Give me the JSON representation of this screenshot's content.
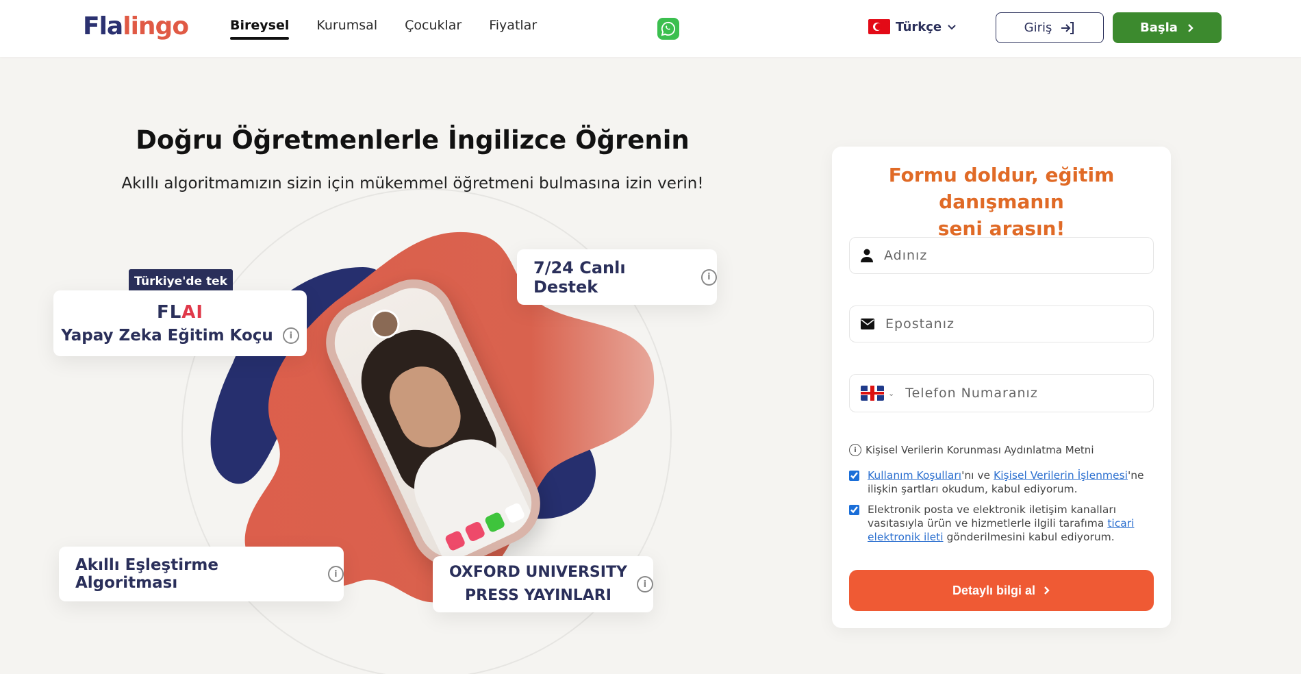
{
  "header": {
    "logo_part1": "Fla",
    "logo_part2": "lingo",
    "nav": [
      {
        "label": "Bireysel",
        "active": true
      },
      {
        "label": "Kurumsal",
        "active": false
      },
      {
        "label": "Çocuklar",
        "active": false
      },
      {
        "label": "Fiyatlar",
        "active": false
      }
    ],
    "language": "Türkçe",
    "login_label": "Giriş",
    "start_label": "Başla"
  },
  "hero": {
    "title": "Doğru Öğretmenlerle İngilizce Öğrenin",
    "subtitle": "Akıllı algoritmamızın sizin için mükemmel öğretmeni bulmasına izin verin!",
    "badge_tek": "Türkiye'de tek",
    "flai_logo_part1": "FL",
    "flai_logo_part2": "AI",
    "card_ai": "Yapay Zeka Eğitim Koçu",
    "card_support": "7/24 Canlı Destek",
    "card_match": "Akıllı Eşleştirme Algoritması",
    "card_oxford_line1": "OXFORD UNIVERSITY",
    "card_oxford_line2": "PRESS YAYINLARI"
  },
  "form": {
    "title_line1": "Formu doldur, eğitim danışmanın",
    "title_line2": "seni arasın!",
    "name_placeholder": "Adınız",
    "email_placeholder": "Epostanız",
    "phone_placeholder": "Telefon Numaranız",
    "kvkk_text": "Kişisel Verilerin Korunması Aydınlatma Metni",
    "consent1": {
      "link1": "Kullanım Koşulları",
      "text1": "'nı ve ",
      "link2": "Kişisel Verilerin İşlenmesi",
      "text2": "'ne ilişkin şartları okudum, kabul ediyorum.",
      "checked": true
    },
    "consent2": {
      "text1": "Elektronik posta ve elektronik iletişim kanalları vasıtasıyla ürün ve hizmetlerle ilgili tarafıma ",
      "link": "ticari elektronik ileti",
      "text2": " gönderilmesini kabul ediyorum.",
      "checked": true
    },
    "submit_label": "Detaylı bilgi al"
  },
  "colors": {
    "brand_navy": "#2b3170",
    "brand_coral": "#e05a45",
    "start_green": "#3c8a2e",
    "form_title_orange": "#e06a26",
    "submit_orange": "#ef5a34"
  },
  "icons": {
    "whatsapp": "whatsapp-icon",
    "login": "login-arrow-icon",
    "chevron": "chevron-right-icon",
    "user": "user-icon",
    "mail": "mail-icon",
    "info": "info-icon"
  }
}
